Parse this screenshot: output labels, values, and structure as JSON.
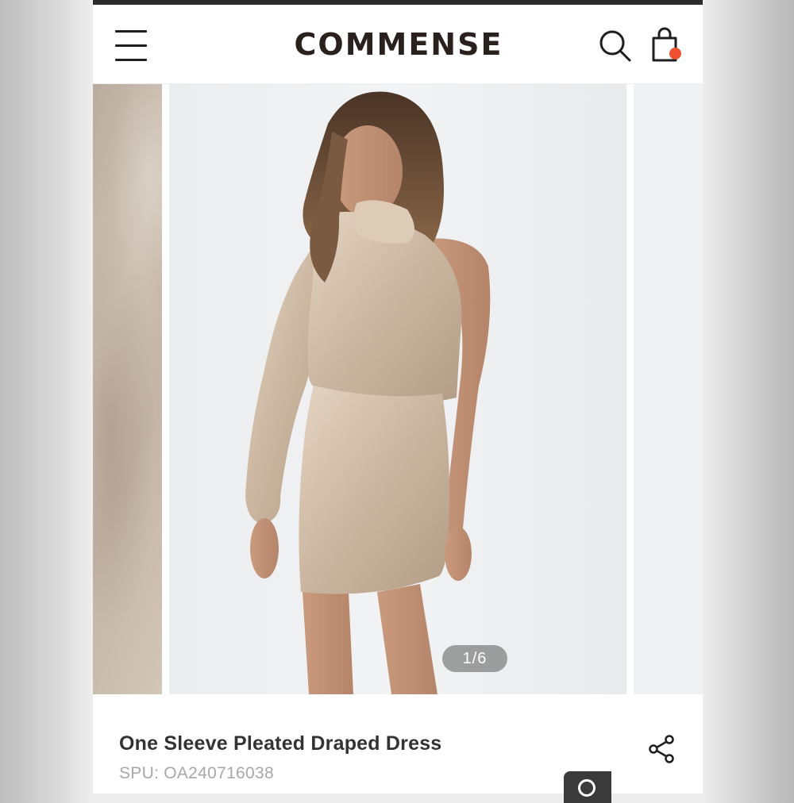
{
  "header": {
    "brand": "COMMENSE",
    "menu_icon": "hamburger-menu-icon",
    "search_icon": "search-icon",
    "cart_icon": "shopping-bag-icon",
    "cart_badge_color": "#f0502f"
  },
  "gallery": {
    "counter": "1/6",
    "current_slide": 1,
    "total_slides": 6
  },
  "product": {
    "title": "One Sleeve Pleated Draped Dress",
    "spu_label": "SPU:",
    "spu_value": "OA240716038",
    "share_icon": "share-icon"
  },
  "colors": {
    "brand_text": "#2a211f",
    "accent": "#f0502f",
    "title_text": "#333333",
    "muted_text": "#a8a8a8"
  }
}
